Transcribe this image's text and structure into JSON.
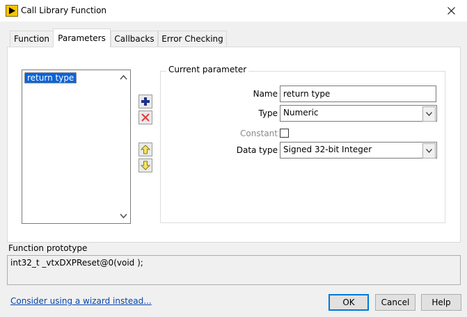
{
  "window": {
    "title": "Call Library Function",
    "close_icon": "close-icon",
    "app_icon": "labview-icon"
  },
  "tabs": [
    {
      "label": "Function",
      "active": false
    },
    {
      "label": "Parameters",
      "active": true
    },
    {
      "label": "Callbacks",
      "active": false
    },
    {
      "label": "Error Checking",
      "active": false
    }
  ],
  "parameters": {
    "list": [
      {
        "label": "return type",
        "selected": true
      }
    ],
    "buttons": {
      "add_icon": "plus-icon",
      "delete_icon": "delete-x-icon",
      "up_icon": "arrow-up-icon",
      "down_icon": "arrow-down-icon"
    },
    "current_parameter": {
      "legend": "Current parameter",
      "name_label": "Name",
      "name_value": "return type",
      "type_label": "Type",
      "type_value": "Numeric",
      "constant_label": "Constant",
      "constant_checked": false,
      "data_type_label": "Data type",
      "data_type_value": "Signed 32-bit Integer"
    }
  },
  "prototype": {
    "label": "Function prototype",
    "text": "int32_t _vtxDXPReset@0(void );"
  },
  "footer": {
    "wizard_link": "Consider using a wizard instead...",
    "ok_label": "OK",
    "cancel_label": "Cancel",
    "help_label": "Help"
  },
  "colors": {
    "selection": "#0a64d8",
    "link": "#0645ad",
    "default_button_border": "#0078d7",
    "add_icon": "#1f2f8c",
    "delete_icon": "#e04040",
    "arrow_icon": "#d8c020"
  }
}
